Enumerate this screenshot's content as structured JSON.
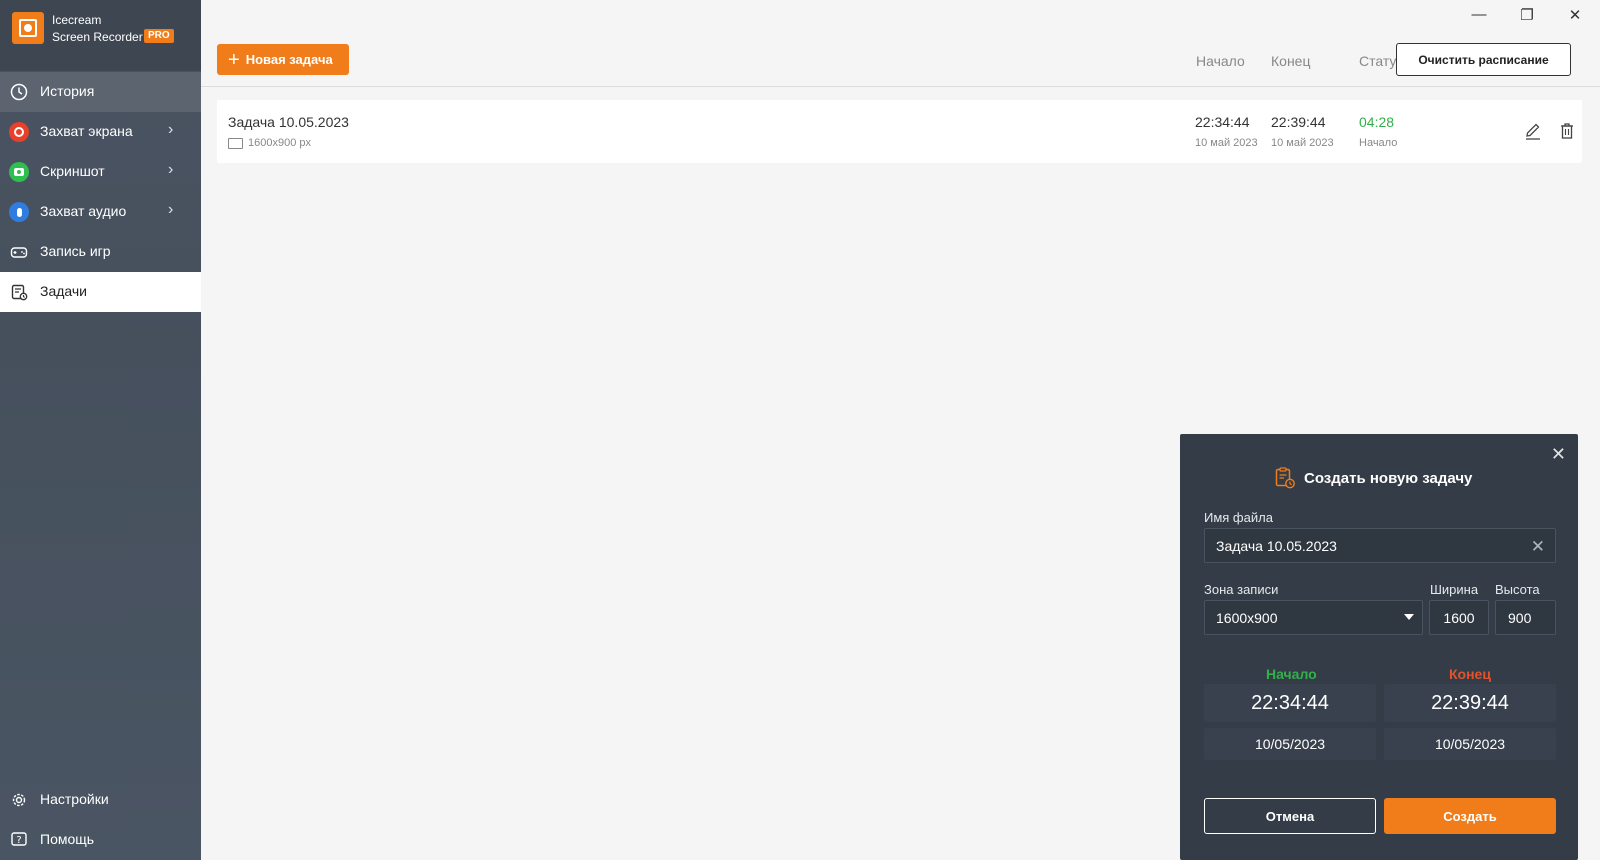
{
  "app": {
    "name_line1": "Icecream",
    "name_line2": "Screen Recorder",
    "badge": "PRO",
    "accent_color": "#f07d1a"
  },
  "sidebar": {
    "items": [
      {
        "label": "История",
        "icon": "clock-icon"
      },
      {
        "label": "Захват экрана",
        "icon": "record-icon"
      },
      {
        "label": "Скриншот",
        "icon": "camera-icon"
      },
      {
        "label": "Захват аудио",
        "icon": "microphone-icon"
      },
      {
        "label": "Запись игр",
        "icon": "gamepad-icon"
      },
      {
        "label": "Задачи",
        "icon": "tasks-icon"
      }
    ],
    "bottom": [
      {
        "label": "Настройки",
        "icon": "gear-icon"
      },
      {
        "label": "Помощь",
        "icon": "help-icon"
      }
    ]
  },
  "window": {
    "minimize": "—",
    "restore": "❐",
    "close": "✕"
  },
  "toolbar": {
    "new_task_label": "Новая задача",
    "col_start": "Начало",
    "col_end": "Конец",
    "col_status": "Статус",
    "clear_schedule_label": "Очистить расписание"
  },
  "tasks": [
    {
      "title": "Задача 10.05.2023",
      "resolution": "1600x900 px",
      "start_time": "22:34:44",
      "start_date": "10 май 2023",
      "end_time": "22:39:44",
      "end_date": "10 май 2023",
      "status_time": "04:28",
      "status_label": "Начало"
    }
  ],
  "dialog": {
    "title": "Создать новую задачу",
    "file_name_label": "Имя файла",
    "file_name_value": "Задача 10.05.2023",
    "zone_label": "Зона записи",
    "zone_value": "1600x900",
    "width_label": "Ширина",
    "width_value": "1600",
    "height_label": "Высота",
    "height_value": "900",
    "start_label": "Начало",
    "end_label": "Конец",
    "start_time": "22:34:44",
    "start_date": "10/05/2023",
    "end_time": "22:39:44",
    "end_date": "10/05/2023",
    "cancel_label": "Отмена",
    "create_label": "Создать"
  }
}
